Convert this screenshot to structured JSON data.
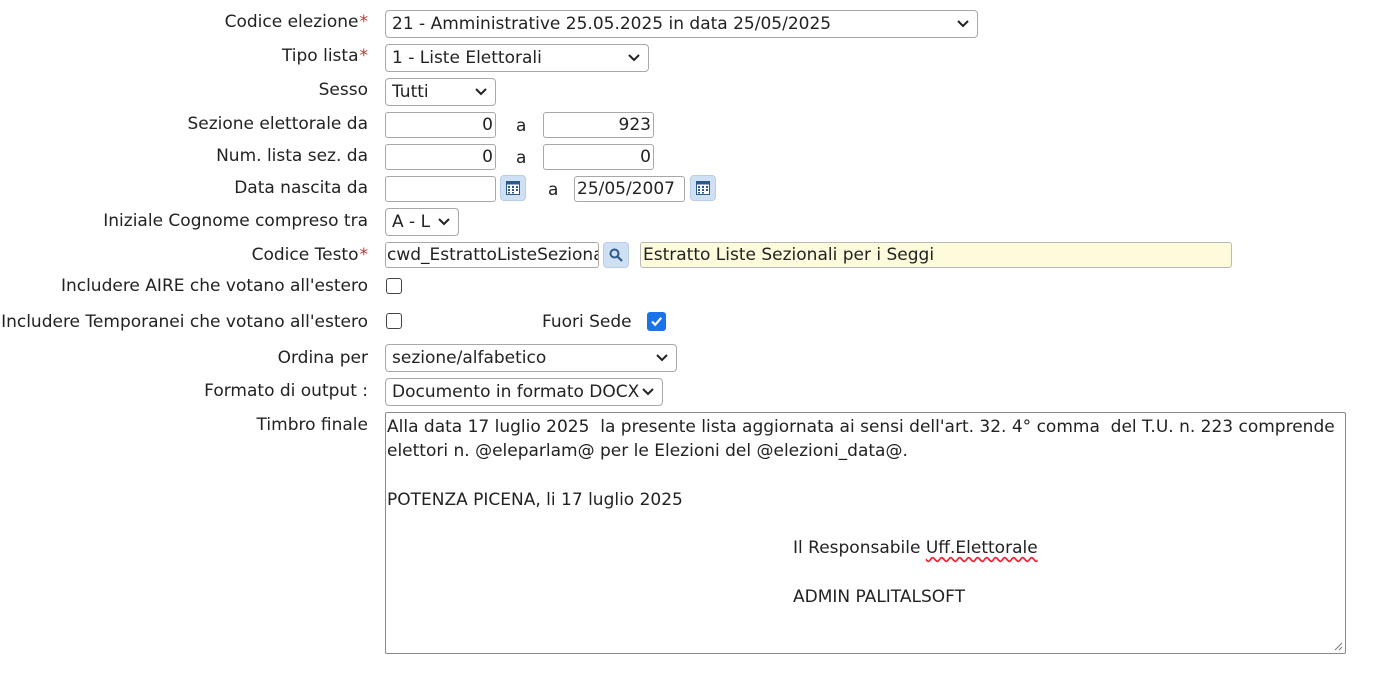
{
  "form": {
    "codice_elezione": {
      "label": "Codice elezione",
      "required_mark": "*",
      "value": "21 - Amministrative 25.05.2025 in data 25/05/2025"
    },
    "tipo_lista": {
      "label": "Tipo lista",
      "required_mark": "*",
      "value": "1 - Liste Elettorali"
    },
    "sesso": {
      "label": "Sesso",
      "value": "Tutti"
    },
    "sezione": {
      "label": "Sezione elettorale da",
      "from": "0",
      "sep": "a",
      "to": "923"
    },
    "num_lista": {
      "label": "Num. lista sez. da",
      "from": "0",
      "sep": "a",
      "to": "0"
    },
    "data_nascita": {
      "label": "Data nascita da",
      "from": "",
      "sep": "a",
      "to": "25/05/2007",
      "calendar_icon": "calendar-icon"
    },
    "iniziale": {
      "label": "Iniziale Cognome compreso tra",
      "value": "A - L"
    },
    "codice_testo": {
      "label": "Codice Testo",
      "required_mark": "*",
      "value": "cwd_EstrattoListeSezionali",
      "description": "Estratto Liste Sezionali per i Seggi",
      "search_icon": "search-icon"
    },
    "aire": {
      "label": "Includere AIRE che votano all'estero",
      "checked": false
    },
    "temporanei": {
      "label": "Includere Temporanei che votano all'estero",
      "checked": false
    },
    "fuori_sede": {
      "label": "Fuori Sede",
      "checked": true
    },
    "ordina": {
      "label": "Ordina per",
      "value": "sezione/alfabetico"
    },
    "formato": {
      "label": "Formato di output :",
      "value": "Documento in formato DOCX"
    },
    "timbro": {
      "label": "Timbro finale",
      "line1": "Alla data 17 luglio 2025  la presente lista aggiornata ai sensi dell'art. 32. 4° comma  del T.U. n. 223 comprende elettori n. @eleparlam@ per le Elezioni del @elezioni_data@.",
      "line2": "POTENZA PICENA, li 17 luglio 2025",
      "sign_prefix": "Il Responsabile ",
      "sign_misspelled": "Uff.Elettorale",
      "sign_name": "ADMIN PALITALSOFT"
    }
  },
  "colors": {
    "required": "#c0392b",
    "accent": "#1a73e8",
    "description_bg": "#fdfbdc",
    "icon_button_bg": "#cfe0f5"
  }
}
